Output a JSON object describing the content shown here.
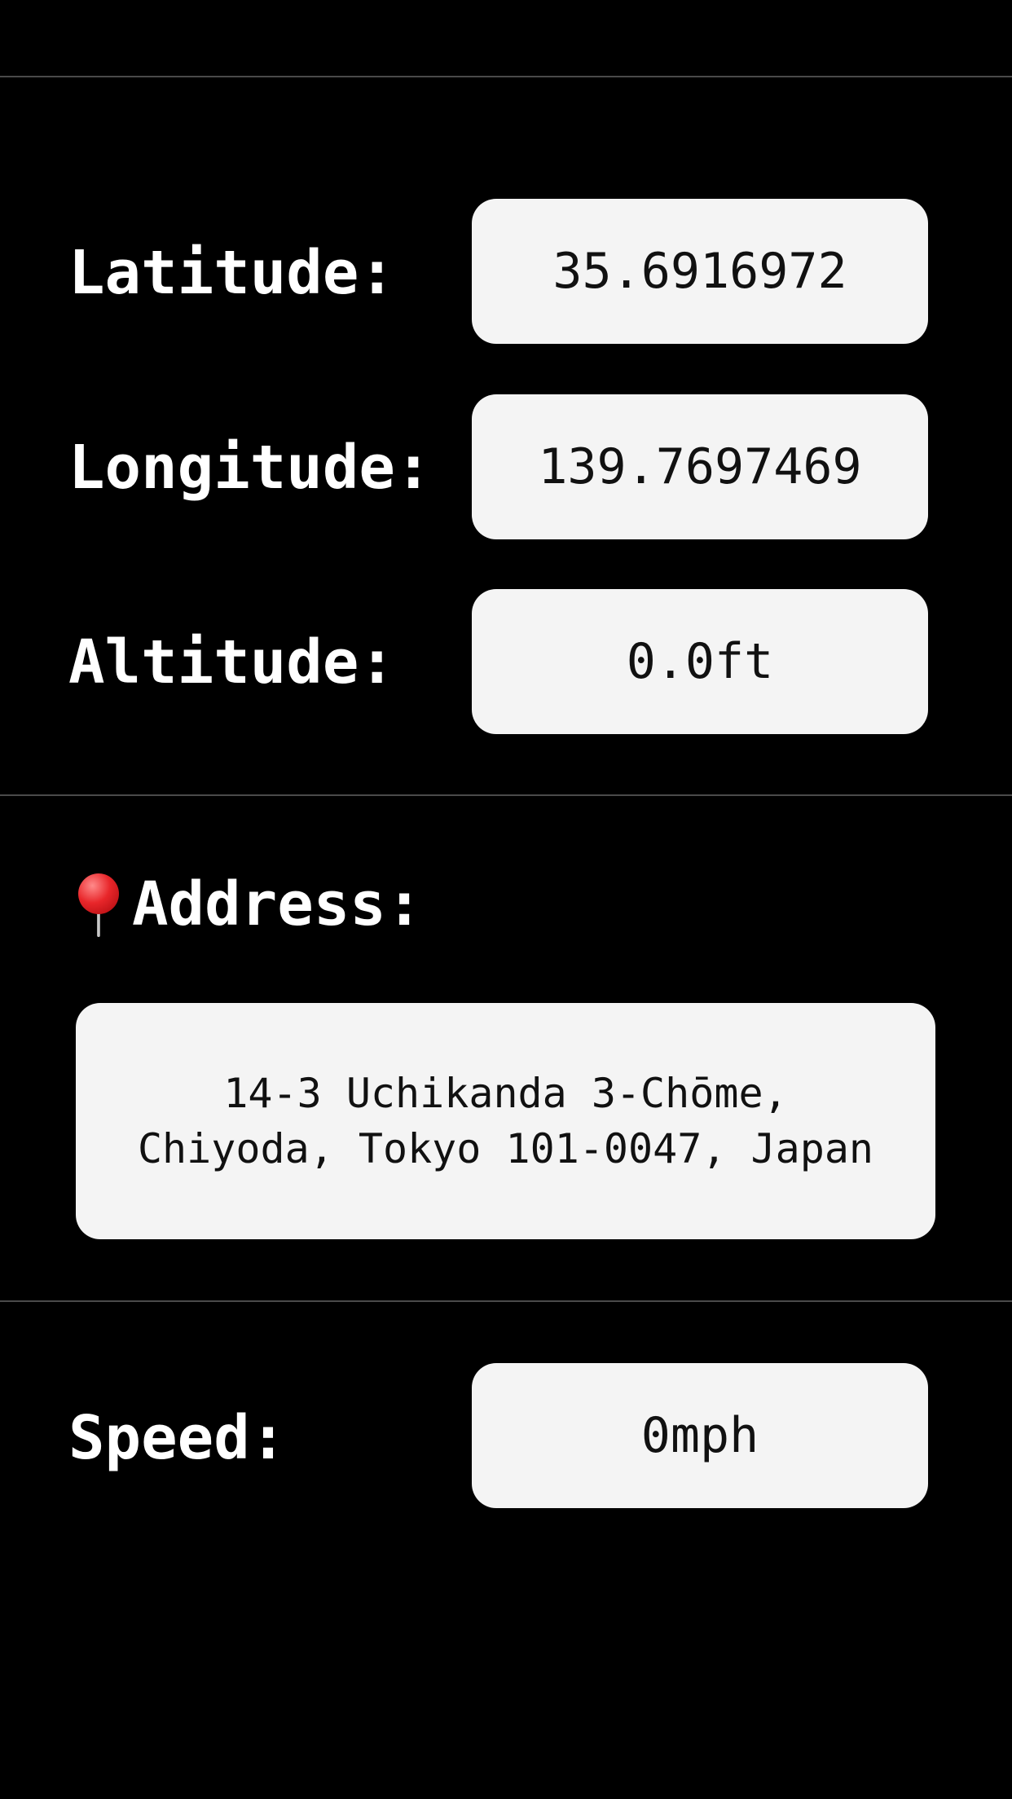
{
  "coordinates": {
    "latitude_label": "Latitude:",
    "latitude_value": "35.6916972",
    "longitude_label": "Longitude:",
    "longitude_value": "139.7697469",
    "altitude_label": "Altitude:",
    "altitude_value": "0.0ft"
  },
  "address": {
    "icon": "round-pushpin-icon",
    "label": "Address:",
    "line1": "14-3 Uchikanda 3-Chōme,",
    "line2": "Chiyoda, Tokyo 101-0047, Japan"
  },
  "speed": {
    "label": "Speed:",
    "value": "0mph"
  },
  "colors": {
    "background": "#000000",
    "box": "#f4f4f4",
    "divider": "#4a4a4a",
    "pin": "#e8262a"
  }
}
